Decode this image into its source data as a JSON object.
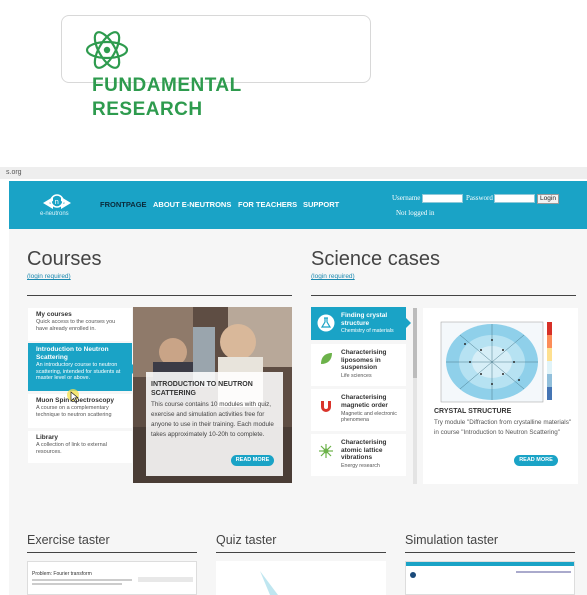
{
  "brand": {
    "line1": "FUNDAMENTAL",
    "line2": "RESEARCH",
    "color": "#2e9b4e"
  },
  "browser": {
    "url_fragment": "s.org"
  },
  "site": {
    "logo_text": "e-neutrons",
    "nav": [
      "FRONTPAGE",
      "ABOUT E-NEUTRONS",
      "FOR TEACHERS",
      "SUPPORT"
    ],
    "login": {
      "username_label": "Username",
      "password_label": "Password",
      "button": "Login",
      "status": "Not logged in"
    },
    "accent": "#1aa3c6"
  },
  "courses": {
    "title": "Courses",
    "login_required": "(login required)",
    "items": [
      {
        "title": "My courses",
        "desc": "Quick access to the courses you have already enrolled in."
      },
      {
        "title": "Introduction to Neutron Scattering",
        "desc": "An introductory course to neutron scattering, intended for students at master level or above."
      },
      {
        "title": "Muon Spin Spectroscopy",
        "desc": "A course on a complementary technique to neutron scattering"
      },
      {
        "title": "Library",
        "desc": "A collection of link to external resources."
      }
    ],
    "feature": {
      "title": "INTRODUCTION TO NEUTRON SCATTERING",
      "body": "This course contains 10 modules with quiz, exercise and simulation activities free for anyone to use in their training. Each module takes approximately 10-20h to complete.",
      "read_more": "READ MORE"
    }
  },
  "science": {
    "title": "Science cases",
    "login_required": "(login required)",
    "items": [
      {
        "title": "Finding crystal structure",
        "sub": "Chemistry of materials",
        "icon": "flask-icon"
      },
      {
        "title": "Characterising liposomes in suspension",
        "sub": "Life sciences",
        "icon": "leaf-icon"
      },
      {
        "title": "Characterising magnetic order",
        "sub": "Magnetic and electronic phenomena",
        "icon": "magnet-icon"
      },
      {
        "title": "Characterising atomic lattice vibrations",
        "sub": "Energy research",
        "icon": "atom-icon"
      }
    ],
    "feature": {
      "title": "CRYSTAL STRUCTURE",
      "body": "Try module \"Diffraction from crystalline materials\" in course \"Introduction to Neutron Scattering\"",
      "read_more": "READ MORE"
    }
  },
  "tasters": {
    "exercise": "Exercise taster",
    "quiz": "Quiz taster",
    "simulation": "Simulation taster",
    "exercise_preview_title": "Problem: Fourier transform"
  }
}
